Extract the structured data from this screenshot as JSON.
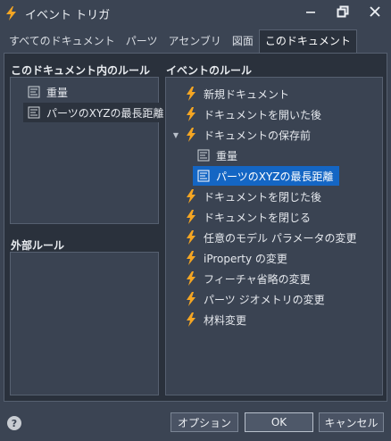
{
  "window": {
    "title": "イベント トリガ",
    "icon": "lightning-icon",
    "controls": [
      "minimize-icon",
      "restore-icon",
      "close-icon"
    ]
  },
  "tabs": [
    {
      "label": "すべてのドキュメント",
      "active": false
    },
    {
      "label": "パーツ",
      "active": false
    },
    {
      "label": "アセンブリ",
      "active": false
    },
    {
      "label": "図面",
      "active": false
    },
    {
      "label": "このドキュメント",
      "active": true
    }
  ],
  "left": {
    "doc_rules_label": "このドキュメント内のルール",
    "doc_rules": [
      {
        "label": "重量",
        "icon": "rule-icon",
        "selected": false
      },
      {
        "label": "パーツのXYZの最長距離",
        "icon": "rule-icon",
        "selected": true
      }
    ],
    "external_rules_label": "外部ルール",
    "external_rules": []
  },
  "right": {
    "event_rules_label": "イベントのルール",
    "events": [
      {
        "label": "新規ドキュメント",
        "icon": "lightning-icon"
      },
      {
        "label": "ドキュメントを開いた後",
        "icon": "lightning-icon"
      },
      {
        "label": "ドキュメントの保存前",
        "icon": "lightning-icon",
        "expanded": true
      },
      {
        "label": "重量",
        "icon": "rule-icon",
        "child": true
      },
      {
        "label": "パーツのXYZの最長距離",
        "icon": "rule-icon",
        "child": true,
        "selected": true
      },
      {
        "label": "ドキュメントを閉じた後",
        "icon": "lightning-icon"
      },
      {
        "label": "ドキュメントを閉じる",
        "icon": "lightning-icon"
      },
      {
        "label": "任意のモデル パラメータの変更",
        "icon": "lightning-icon"
      },
      {
        "label": "iProperty の変更",
        "icon": "lightning-icon"
      },
      {
        "label": "フィーチャ省略の変更",
        "icon": "lightning-icon"
      },
      {
        "label": "パーツ ジオメトリの変更",
        "icon": "lightning-icon"
      },
      {
        "label": "材料変更",
        "icon": "lightning-icon"
      }
    ]
  },
  "footer": {
    "help": "?",
    "options_label": "オプション",
    "ok_label": "OK",
    "cancel_label": "キャンセル"
  },
  "colors": {
    "lightning": "#f5a623",
    "selection_blue": "#1466c4",
    "window_bg": "#3b4453",
    "content_bg": "#2a313c"
  }
}
